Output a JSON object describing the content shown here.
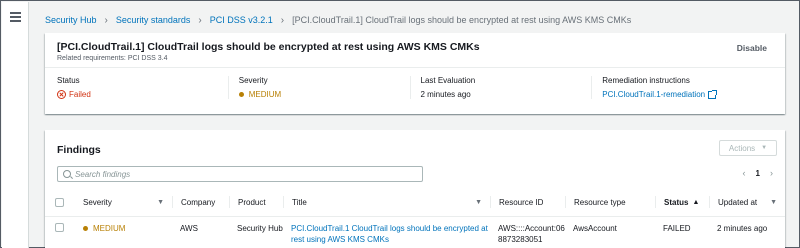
{
  "breadcrumb": {
    "items": [
      "Security Hub",
      "Security standards",
      "PCI DSS v3.2.1"
    ],
    "current": "[PCI.CloudTrail.1] CloudTrail logs should be encrypted at rest using AWS KMS CMKs"
  },
  "summary": {
    "title": "[PCI.CloudTrail.1] CloudTrail logs should be encrypted at rest using AWS KMS CMKs",
    "related": "Related requirements: PCI DSS 3.4",
    "disable_label": "Disable",
    "status_label": "Status",
    "status_value": "Failed",
    "severity_label": "Severity",
    "severity_value": "MEDIUM",
    "last_eval_label": "Last Evaluation",
    "last_eval_value": "2 minutes ago",
    "remediation_label": "Remediation instructions",
    "remediation_link": "PCI.CloudTrail.1-remediation"
  },
  "findings": {
    "title": "Findings",
    "actions_label": "Actions",
    "search_placeholder": "Search findings",
    "page": "1",
    "columns": [
      "Severity",
      "Company",
      "Product",
      "Title",
      "Resource ID",
      "Resource type",
      "Status",
      "Updated at"
    ],
    "rows": [
      {
        "severity": "MEDIUM",
        "company": "AWS",
        "product": "Security Hub",
        "title": "PCI.CloudTrail.1 CloudTrail logs should be encrypted at rest using AWS KMS CMKs",
        "resource_id": "AWS::::Account:068873283051",
        "resource_type": "AwsAccount",
        "status": "FAILED",
        "updated_at": "2 minutes ago"
      }
    ]
  },
  "colors": {
    "link": "#0073bb",
    "failed": "#d13212",
    "medium": "#b88005",
    "background": "#f2f3f3"
  },
  "icons": {
    "menu": "hamburger-icon",
    "status": "x-circle-icon",
    "severity": "dot-icon",
    "external": "external-link-icon",
    "search": "search-icon"
  }
}
